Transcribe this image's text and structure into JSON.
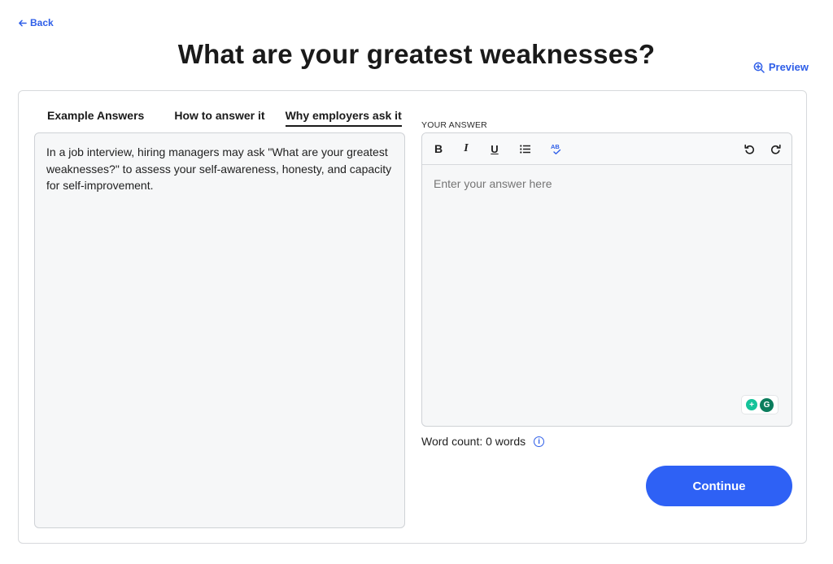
{
  "nav": {
    "back_label": "Back",
    "preview_label": "Preview"
  },
  "page": {
    "title": "What are your greatest weaknesses?"
  },
  "tabs": [
    {
      "label": "Example Answers",
      "active": false
    },
    {
      "label": "How to answer it",
      "active": false
    },
    {
      "label": "Why employers ask it",
      "active": true
    }
  ],
  "explanation": {
    "text": "In a job interview, hiring managers may ask \"What are your greatest weaknesses?\" to assess your self-awareness, honesty, and capacity for self-improvement."
  },
  "answer": {
    "label": "YOUR ANSWER",
    "placeholder": "Enter your answer here",
    "value": "",
    "toolbar": {
      "bold": "B",
      "italic": "I",
      "underline": "U",
      "spellcheck": "AB"
    }
  },
  "word_count": {
    "text": "Word count: 0 words"
  },
  "actions": {
    "continue_label": "Continue"
  },
  "colors": {
    "accent": "#2e61f5",
    "link": "#2e5ee8",
    "grammarly": "#15c39a"
  },
  "icons": [
    "arrow-left-icon",
    "zoom-in-icon",
    "list-icon",
    "spellcheck-icon",
    "undo-icon",
    "redo-icon",
    "info-icon",
    "grammarly-icon"
  ]
}
